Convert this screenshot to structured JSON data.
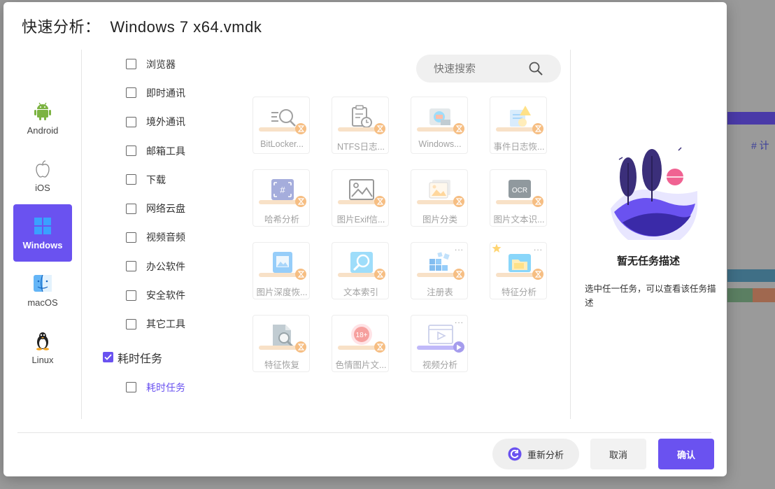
{
  "dialog": {
    "title_label": "快速分析：",
    "file_name": "Windows 7 x64.vmdk"
  },
  "os_list": [
    {
      "label": "Android",
      "icon": "android-icon"
    },
    {
      "label": "iOS",
      "icon": "apple-icon"
    },
    {
      "label": "Windows",
      "icon": "windows-icon",
      "active": true
    },
    {
      "label": "macOS",
      "icon": "finder-icon"
    },
    {
      "label": "Linux",
      "icon": "penguin-icon"
    }
  ],
  "categories": [
    {
      "label": "浏览器",
      "checked": false
    },
    {
      "label": "即时通讯",
      "checked": false
    },
    {
      "label": "境外通讯",
      "checked": false
    },
    {
      "label": "邮箱工具",
      "checked": false
    },
    {
      "label": "下载",
      "checked": false
    },
    {
      "label": "网络云盘",
      "checked": false
    },
    {
      "label": "视频音频",
      "checked": false
    },
    {
      "label": "办公软件",
      "checked": false
    },
    {
      "label": "安全软件",
      "checked": false
    },
    {
      "label": "其它工具",
      "checked": false
    }
  ],
  "time_group": {
    "label": "耗时任务",
    "checked": true,
    "sub_label": "耗时任务",
    "sub_checked": false
  },
  "search": {
    "placeholder": "快速搜索"
  },
  "tiles": [
    {
      "label": "BitLocker...",
      "icon": "magnify-list-icon"
    },
    {
      "label": "NTFS日志...",
      "icon": "clipboard-clock-icon"
    },
    {
      "label": "Windows...",
      "icon": "windows-image-icon"
    },
    {
      "label": "事件日志恢...",
      "icon": "event-log-icon"
    },
    {
      "label": "哈希分析",
      "icon": "hash-scan-icon"
    },
    {
      "label": "图片Exif信...",
      "icon": "image-icon"
    },
    {
      "label": "图片分类",
      "icon": "photo-stack-icon"
    },
    {
      "label": "图片文本识...",
      "icon": "ocr-icon",
      "ocr_text": "OCR"
    },
    {
      "label": "图片深度恢...",
      "icon": "image-recover-icon"
    },
    {
      "label": "文本索引",
      "icon": "text-index-icon"
    },
    {
      "label": "注册表",
      "icon": "registry-icon",
      "more": "..."
    },
    {
      "label": "特征分析",
      "icon": "folder-feature-icon",
      "starred": true,
      "more": "..."
    },
    {
      "label": "特征恢复",
      "icon": "file-search-icon"
    },
    {
      "label": "色情图片文...",
      "icon": "adult-content-icon",
      "badge_text": "18+"
    },
    {
      "label": "视频分析",
      "icon": "video-icon",
      "more": "..."
    }
  ],
  "right_panel": {
    "title": "暂无任务描述",
    "description": "选中任一任务，可以查看该任务描述"
  },
  "footer": {
    "reanalyze_label": "重新分析",
    "cancel_label": "取消",
    "confirm_label": "确认"
  },
  "background": {
    "hash_text": "# 计"
  },
  "colors": {
    "accent": "#6a52f0",
    "hourglass": "#f08a1e"
  }
}
